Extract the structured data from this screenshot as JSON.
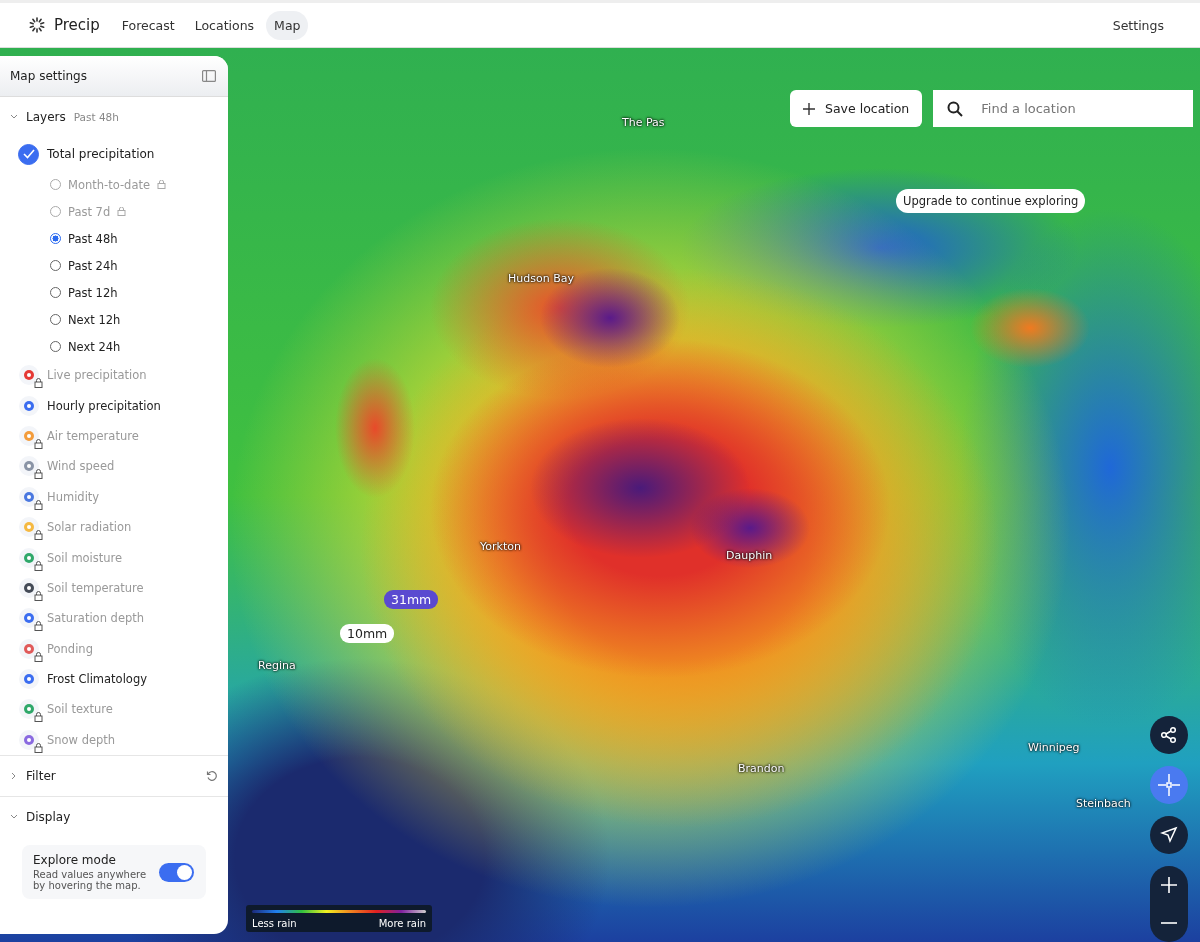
{
  "nav": {
    "brand": "Precip",
    "links": [
      {
        "label": "Forecast",
        "selected": false
      },
      {
        "label": "Locations",
        "selected": false
      },
      {
        "label": "Map",
        "selected": true
      }
    ],
    "settings": "Settings"
  },
  "panel": {
    "title": "Map settings",
    "layers": {
      "label": "Layers",
      "summary": "Past 48h",
      "expanded": true,
      "primary": {
        "label": "Total precipitation",
        "checked": true,
        "options": [
          {
            "label": "Month-to-date",
            "selected": false,
            "locked": true
          },
          {
            "label": "Past 7d",
            "selected": false,
            "locked": true
          },
          {
            "label": "Past 48h",
            "selected": true,
            "locked": false
          },
          {
            "label": "Past 24h",
            "selected": false,
            "locked": false
          },
          {
            "label": "Past 12h",
            "selected": false,
            "locked": false
          },
          {
            "label": "Next 12h",
            "selected": false,
            "locked": false
          },
          {
            "label": "Next 24h",
            "selected": false,
            "locked": false
          }
        ]
      },
      "items": [
        {
          "label": "Live precipitation",
          "locked": true,
          "color": "#e53935"
        },
        {
          "label": "Hourly precipitation",
          "locked": false,
          "color": "#3b6df0"
        },
        {
          "label": "Air temperature",
          "locked": true,
          "color": "#f39c3c"
        },
        {
          "label": "Wind speed",
          "locked": true,
          "color": "#8a94a6"
        },
        {
          "label": "Humidity",
          "locked": true,
          "color": "#4a78e0"
        },
        {
          "label": "Solar radiation",
          "locked": true,
          "color": "#f5b942"
        },
        {
          "label": "Soil moisture",
          "locked": true,
          "color": "#2fa86a"
        },
        {
          "label": "Soil temperature",
          "locked": true,
          "color": "#444b57"
        },
        {
          "label": "Saturation depth",
          "locked": true,
          "color": "#3b6df0"
        },
        {
          "label": "Ponding",
          "locked": true,
          "color": "#e05a5a"
        },
        {
          "label": "Frost Climatology",
          "locked": false,
          "color": "#3b6df0"
        },
        {
          "label": "Soil texture",
          "locked": true,
          "color": "#2fa86a"
        },
        {
          "label": "Snow depth",
          "locked": true,
          "color": "#8a6ae0"
        }
      ]
    },
    "filter": {
      "label": "Filter",
      "expanded": false
    },
    "display": {
      "label": "Display",
      "expanded": true,
      "explore": {
        "title": "Explore mode",
        "description": "Read values anywhere by hovering the map.",
        "on": true
      }
    }
  },
  "map": {
    "save": "Save location",
    "search_placeholder": "Find a location",
    "upgrade": "Upgrade to continue exploring",
    "places": [
      "The Pas",
      "Hudson Bay",
      "Yorkton",
      "Dauphin",
      "Regina",
      "Brandon",
      "Winnipeg",
      "Steinbach"
    ],
    "readings": [
      {
        "value": "31mm",
        "kind": "dark"
      },
      {
        "value": "10mm",
        "kind": "light"
      }
    ],
    "legend": {
      "low": "Less rain",
      "high": "More rain"
    }
  }
}
